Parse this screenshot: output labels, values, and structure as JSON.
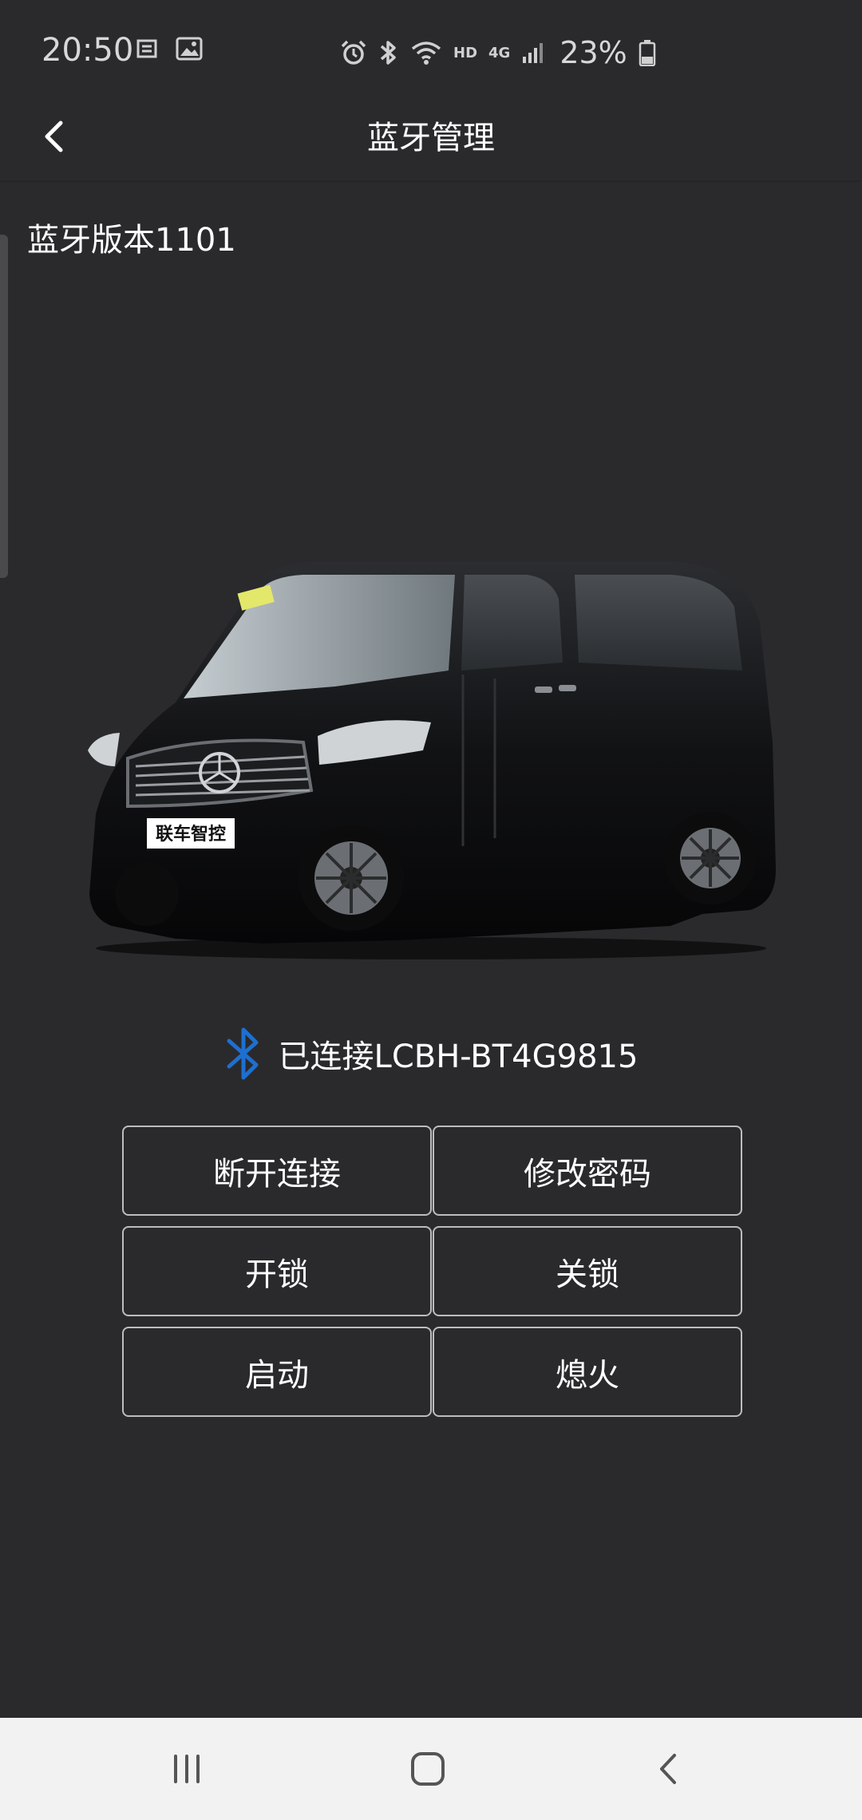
{
  "status_bar": {
    "time": "20:50",
    "battery_percent": "23%",
    "network_label": "4G",
    "hd_label": "HD"
  },
  "app_bar": {
    "title": "蓝牙管理"
  },
  "bluetooth_version": "蓝牙版本1101",
  "car": {
    "plate_text": "联车智控"
  },
  "connection": {
    "status_text": "已连接LCBH-BT4G9815",
    "icon_color": "#1e6fd0"
  },
  "controls": [
    {
      "label": "断开连接"
    },
    {
      "label": "修改密码"
    },
    {
      "label": "开锁"
    },
    {
      "label": "关锁"
    },
    {
      "label": "启动"
    },
    {
      "label": "熄火"
    }
  ],
  "nav": {
    "items": [
      "recent-apps-icon",
      "home-icon",
      "back-icon"
    ]
  }
}
